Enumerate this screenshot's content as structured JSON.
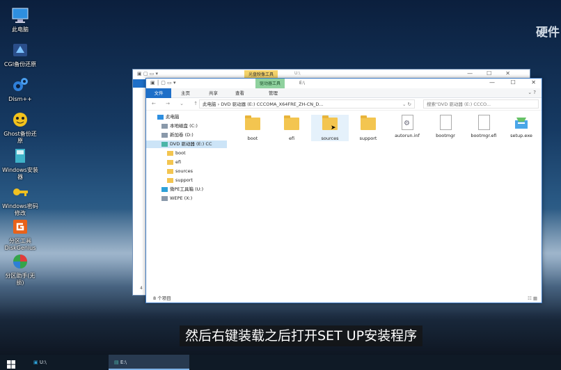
{
  "desktop": {
    "icons": [
      {
        "label": "此电脑",
        "icon": "computer-icon"
      },
      {
        "label": "CGI备份还原",
        "icon": "cgi-backup-icon"
      },
      {
        "label": "Dism++",
        "icon": "dism-gear-icon"
      },
      {
        "label": "Ghost备份还原",
        "icon": "ghost-icon"
      },
      {
        "label": "Windows安装器",
        "icon": "windows-installer-icon"
      },
      {
        "label": "Windows密码修改",
        "icon": "key-icon"
      },
      {
        "label": "分区工具DiskGenius",
        "icon": "diskgenius-icon"
      },
      {
        "label": "分区助手(无损)",
        "icon": "partition-assistant-icon"
      }
    ],
    "watermark": "硬件"
  },
  "back_window": {
    "tag": "光盘映像工具",
    "path": "U:\\",
    "side_number": "4"
  },
  "window": {
    "tag": "驱动器工具",
    "path": "E:\\",
    "ribbon_tabs": [
      "文件",
      "主页",
      "共享",
      "查看",
      "管理"
    ],
    "address": "此电脑 › DVD 驱动器 (E:) CCCOMA_X64FRE_ZH-CN_D...",
    "search_placeholder": "搜索\"DVD 驱动器 (E:) CCCO...",
    "nav": [
      {
        "label": "此电脑",
        "icon": "computer-icon"
      },
      {
        "label": "本地磁盘 (C:)",
        "icon": "drive-icon"
      },
      {
        "label": "新加卷 (D:)",
        "icon": "drive-icon"
      },
      {
        "label": "DVD 驱动器 (E:) CC",
        "icon": "dvd-drive-icon"
      },
      {
        "label": "boot",
        "icon": "folder-icon"
      },
      {
        "label": "efi",
        "icon": "folder-icon"
      },
      {
        "label": "sources",
        "icon": "folder-icon"
      },
      {
        "label": "support",
        "icon": "folder-icon"
      },
      {
        "label": "微PE工具箱 (U:)",
        "icon": "usb-drive-icon"
      },
      {
        "label": "WEPE (X:)",
        "icon": "drive-icon"
      }
    ],
    "files": [
      {
        "name": "boot",
        "type": "folder"
      },
      {
        "name": "efi",
        "type": "folder"
      },
      {
        "name": "sources",
        "type": "folder"
      },
      {
        "name": "support",
        "type": "folder"
      },
      {
        "name": "autorun.inf",
        "type": "settings"
      },
      {
        "name": "bootmgr",
        "type": "file"
      },
      {
        "name": "bootmgr.efi",
        "type": "file"
      },
      {
        "name": "setup.exe",
        "type": "setup"
      }
    ],
    "status": "8 个项目"
  },
  "subtitle": "然后右键装载之后打开SET UP安装程序",
  "taskbar": {
    "items": [
      {
        "label": "U:\\"
      },
      {
        "label": "E:\\"
      }
    ]
  }
}
